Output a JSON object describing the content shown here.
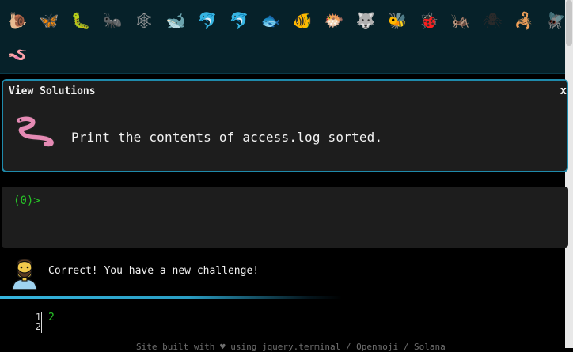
{
  "challenges": [
    {
      "icon": "snail-icon",
      "glyph": "🐌",
      "color": "#b27a3b"
    },
    {
      "icon": "butterfly-icon",
      "glyph": "🦋",
      "color": "#e07a2a"
    },
    {
      "icon": "caterpillar-icon",
      "glyph": "🐛",
      "color": "#58b32c"
    },
    {
      "icon": "ant-icon",
      "glyph": "🐜",
      "color": "#3a2a22"
    },
    {
      "icon": "spiderweb-icon",
      "glyph": "🕸",
      "color": "#9a9a9a"
    },
    {
      "icon": "whale-icon",
      "glyph": "🐋",
      "color": "#3d8fd1"
    },
    {
      "icon": "dolphin-icon",
      "glyph": "🐬",
      "color": "#3d8fd1"
    },
    {
      "icon": "dolphin-grey-icon",
      "glyph": "🐬",
      "color": "#9aa6ad"
    },
    {
      "icon": "fish-icon",
      "glyph": "🐟",
      "color": "#3d8fd1"
    },
    {
      "icon": "tropical-fish-icon",
      "glyph": "🐠",
      "color": "#f0c13a"
    },
    {
      "icon": "blowfish-icon",
      "glyph": "🐡",
      "color": "#c49a5a"
    },
    {
      "icon": "wolf-icon",
      "glyph": "🐺",
      "color": "#8e8e8e"
    },
    {
      "icon": "bee-icon",
      "glyph": "🐝",
      "color": "#f2c21b"
    },
    {
      "icon": "ladybug-icon",
      "glyph": "🐞",
      "color": "#d92a2a"
    },
    {
      "icon": "cricket-icon",
      "glyph": "🦗",
      "color": "#58b32c"
    },
    {
      "icon": "spider-icon",
      "glyph": "🕷",
      "color": "#2a2a2a"
    },
    {
      "icon": "scorpion-icon",
      "glyph": "🦂",
      "color": "#c0251f"
    },
    {
      "icon": "fly-icon",
      "glyph": "🪰",
      "color": "#2a2a2a"
    },
    {
      "icon": "worm-icon",
      "glyph": "🪱",
      "color": "#e07ab0"
    }
  ],
  "modal": {
    "title": "View Solutions",
    "close_label": "x",
    "challenge_icon": "worm-icon",
    "challenge_text": "Print the contents of access.log sorted."
  },
  "terminal": {
    "prompt_open": "(",
    "prompt_count": "0",
    "prompt_close": ")>"
  },
  "feedback": {
    "avatar_icon": "bearded-man-icon",
    "message": "Correct! You have a new challenge!",
    "bar_color": "#36b6df"
  },
  "editor": {
    "line_numbers": [
      "1",
      "2"
    ],
    "lines": [
      "2",
      ""
    ]
  },
  "footer": {
    "text": "Site built with ♥ using jquery.terminal / Openmoji / Solana"
  }
}
